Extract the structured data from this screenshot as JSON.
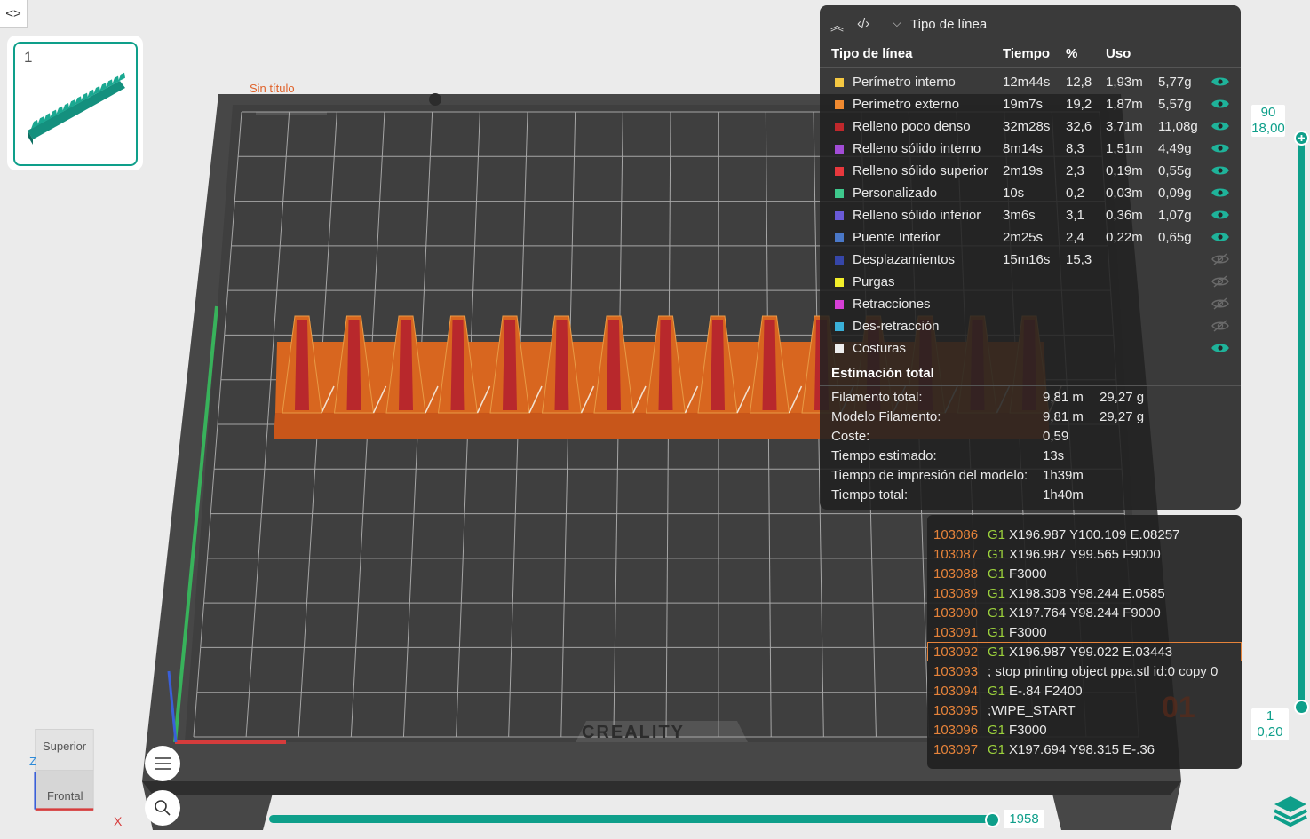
{
  "toolbar": {
    "toggle_icon": "code-toggle-icon",
    "toggle_glyph": "<>"
  },
  "plate": {
    "number": "1"
  },
  "scene": {
    "project_title": "Sin título",
    "brand": "CREALITY",
    "accent": "#0e9f8a",
    "model_color": "#d8661f"
  },
  "legend": {
    "dropdown_label": "Tipo de línea",
    "headers": {
      "type": "Tipo de línea",
      "time": "Tiempo",
      "percent": "%",
      "usage": "Uso"
    },
    "rows": [
      {
        "name": "Perímetro interno",
        "color": "#f5c842",
        "time": "12m44s",
        "pct": "12,8",
        "len": "1,93m",
        "weight": "5,77g",
        "visible": true
      },
      {
        "name": "Perímetro externo",
        "color": "#f08a30",
        "time": "19m7s",
        "pct": "19,2",
        "len": "1,87m",
        "weight": "5,57g",
        "visible": true
      },
      {
        "name": "Relleno poco denso",
        "color": "#c0282c",
        "time": "32m28s",
        "pct": "32,6",
        "len": "3,71m",
        "weight": "11,08g",
        "visible": true
      },
      {
        "name": "Relleno sólido interno",
        "color": "#a24cd6",
        "time": "8m14s",
        "pct": "8,3",
        "len": "1,51m",
        "weight": "4,49g",
        "visible": true
      },
      {
        "name": "Relleno sólido superior",
        "color": "#e8383d",
        "time": "2m19s",
        "pct": "2,3",
        "len": "0,19m",
        "weight": "0,55g",
        "visible": true
      },
      {
        "name": "Personalizado",
        "color": "#3ec88c",
        "time": "10s",
        "pct": "0,2",
        "len": "0,03m",
        "weight": "0,09g",
        "visible": true
      },
      {
        "name": "Relleno sólido inferior",
        "color": "#6a5ad8",
        "time": "3m6s",
        "pct": "3,1",
        "len": "0,36m",
        "weight": "1,07g",
        "visible": true
      },
      {
        "name": "Puente Interior",
        "color": "#4a78c8",
        "time": "2m25s",
        "pct": "2,4",
        "len": "0,22m",
        "weight": "0,65g",
        "visible": true
      },
      {
        "name": "Desplazamientos",
        "color": "#3646a8",
        "time": "15m16s",
        "pct": "15,3",
        "len": "",
        "weight": "",
        "visible": false
      },
      {
        "name": "Purgas",
        "color": "#f2ee2a",
        "time": "",
        "pct": "",
        "len": "",
        "weight": "",
        "visible": false
      },
      {
        "name": "Retracciones",
        "color": "#d63fd6",
        "time": "",
        "pct": "",
        "len": "",
        "weight": "",
        "visible": false
      },
      {
        "name": "Des-retracción",
        "color": "#3ab0d8",
        "time": "",
        "pct": "",
        "len": "",
        "weight": "",
        "visible": false
      },
      {
        "name": "Costuras",
        "color": "#eeeeee",
        "time": "",
        "pct": "",
        "len": "",
        "weight": "",
        "visible": true
      }
    ],
    "estimate": {
      "title": "Estimación total",
      "rows": [
        {
          "label": "Filamento total:",
          "a": "9,81 m",
          "b": "29,27 g"
        },
        {
          "label": "Modelo Filamento:",
          "a": "9,81 m",
          "b": "29,27 g"
        },
        {
          "label": "Coste:",
          "a": "0,59",
          "b": ""
        },
        {
          "label": "Tiempo estimado:",
          "a": "13s",
          "b": ""
        },
        {
          "label": "Tiempo de impresión del modelo:",
          "a": "1h39m",
          "b": ""
        },
        {
          "label": "Tiempo total:",
          "a": "1h40m",
          "b": ""
        }
      ]
    }
  },
  "gcode": {
    "lines": [
      {
        "num": "103086",
        "cmd": "G1",
        "args": "X196.987 Y100.109 E.08257",
        "selected": false
      },
      {
        "num": "103087",
        "cmd": "G1",
        "args": "X196.987 Y99.565 F9000",
        "selected": false
      },
      {
        "num": "103088",
        "cmd": "G1",
        "args": "F3000",
        "selected": false
      },
      {
        "num": "103089",
        "cmd": "G1",
        "args": "X198.308 Y98.244 E.0585",
        "selected": false
      },
      {
        "num": "103090",
        "cmd": "G1",
        "args": "X197.764 Y98.244 F9000",
        "selected": false
      },
      {
        "num": "103091",
        "cmd": "G1",
        "args": "F3000",
        "selected": false
      },
      {
        "num": "103092",
        "cmd": "G1",
        "args": "X196.987 Y99.022 E.03443",
        "selected": true
      },
      {
        "num": "103093",
        "cmd": "",
        "args": "; stop printing object ppa.stl id:0 copy 0",
        "selected": false
      },
      {
        "num": "103094",
        "cmd": "G1",
        "args": "E-.84 F2400",
        "selected": false
      },
      {
        "num": "103095",
        "cmd": "",
        "args": ";WIPE_START",
        "selected": false
      },
      {
        "num": "103096",
        "cmd": "G1",
        "args": "F3000",
        "selected": false
      },
      {
        "num": "103097",
        "cmd": "G1",
        "args": "X197.694 Y98.315 E-.36",
        "selected": false
      }
    ]
  },
  "layer_slider": {
    "top_layer": "90",
    "top_height": "18,00",
    "bottom_layer": "1",
    "bottom_height": "0,20"
  },
  "move_slider": {
    "value": "1958"
  },
  "nav_cube": {
    "top": "Superior",
    "front": "Frontal",
    "axis_z": "Z",
    "axis_x": "X"
  },
  "buttons": {
    "menu_icon": "menu-icon",
    "search_icon": "search-icon",
    "layers_icon": "layers-icon"
  }
}
